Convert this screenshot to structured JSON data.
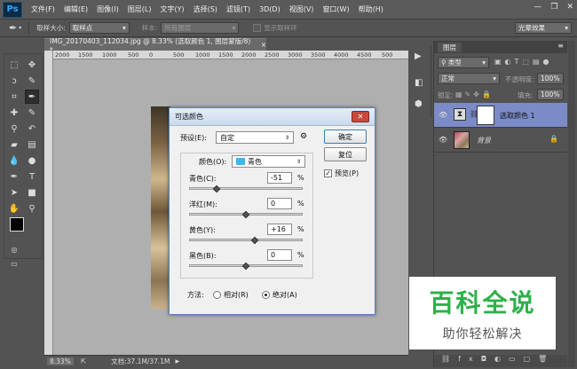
{
  "app": {
    "logo": "Ps"
  },
  "menu": [
    "文件(F)",
    "编辑(E)",
    "图像(I)",
    "图层(L)",
    "文字(Y)",
    "选择(S)",
    "滤镜(T)",
    "3D(D)",
    "视图(V)",
    "窗口(W)",
    "帮助(H)"
  ],
  "window_controls": {
    "minimize": "—",
    "restore": "❐",
    "close": "✕"
  },
  "options_bar": {
    "sample_size_label": "取样大小:",
    "sample_size_value": "取样点",
    "sample_label": "样本:",
    "sample_value": "所有图层",
    "show_ring_label": "显示取样环",
    "workspace": "光晕效果"
  },
  "document": {
    "tab_title": "IMG_20170403_112034.jpg @ 8.33% (选取颜色 1, 图层蒙版/8) *",
    "tab_close": "×",
    "ruler_ticks": [
      "2000",
      "1500",
      "1000",
      "500",
      "0",
      "500",
      "1000",
      "1500",
      "2000",
      "2500",
      "3000",
      "3500",
      "4000",
      "4500",
      "500"
    ],
    "zoom": "8.33%",
    "doc_info": "文档:37.1M/37.1M"
  },
  "dialog": {
    "title": "可选颜色",
    "close": "✕",
    "preset_label": "预设(E):",
    "preset_value": "自定",
    "colors_label": "颜色(O):",
    "colors_value": "青色",
    "color_swatch": "#3db6ef",
    "sliders": [
      {
        "label": "青色(C):",
        "value": "-51",
        "level": 0.245
      },
      {
        "label": "洋红(M):",
        "value": "0",
        "level": 0.5
      },
      {
        "label": "黄色(Y):",
        "value": "+16",
        "level": 0.58
      },
      {
        "label": "黑色(B):",
        "value": "0",
        "level": 0.5
      }
    ],
    "percent": "%",
    "method_label": "方法:",
    "method_relative": "相对(R)",
    "method_absolute": "绝对(A)",
    "method_selected": "absolute",
    "ok": "确定",
    "reset": "复位",
    "preview_label": "预览(P)",
    "preview_checked": true
  },
  "layers_panel": {
    "tab": "图层",
    "filter_kind": "类型",
    "blend_mode": "正常",
    "opacity_label": "不透明度:",
    "opacity_value": "100%",
    "lock_label": "锁定:",
    "fill_label": "填充:",
    "fill_value": "100%",
    "layers": [
      {
        "name": "选取颜色 1",
        "selected": true
      },
      {
        "name": "背景",
        "selected": false
      }
    ]
  },
  "watermark": {
    "title": "百科全说",
    "subtitle": "助你轻松解决"
  },
  "colors": {
    "accent_selected_layer": "#7b8bc8"
  }
}
